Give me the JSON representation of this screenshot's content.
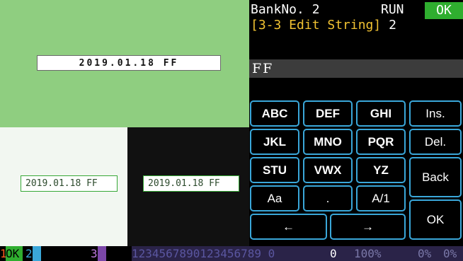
{
  "preview": {
    "main_text": "2019.01.18 FF",
    "light_text": "2019.01.18 FF",
    "dark_text": "2019.01.18 FF"
  },
  "header": {
    "bank_label": "BankNo. 2",
    "run_label": "RUN",
    "ok_label": "OK",
    "menu_title": "[3-3 Edit String]",
    "menu_index": "2"
  },
  "editor": {
    "value": "FF"
  },
  "keypad": {
    "abc": "ABC",
    "def": "DEF",
    "ghi": "GHI",
    "ins": "Ins.",
    "jkl": "JKL",
    "mno": "MNO",
    "pqr": "PQR",
    "del": "Del.",
    "stu": "STU",
    "vwx": "VWX",
    "yz": "YZ",
    "back": "Back",
    "case": "Aa",
    "dot": ".",
    "alnum": "A/1",
    "ok": "OK",
    "left": "←",
    "right": "→"
  },
  "status": {
    "slot1_num": "1",
    "slot1_label": "OK",
    "slot2_num": "2",
    "slot3_num": "3",
    "digits": "1234567890123456789 0",
    "counter": "0",
    "percent1": "100%",
    "percent2": "0%",
    "percent3": "0%"
  },
  "colors": {
    "accent_green": "#2fae2f",
    "key_border": "#3aa7d9",
    "title_orange": "#f1c232"
  }
}
